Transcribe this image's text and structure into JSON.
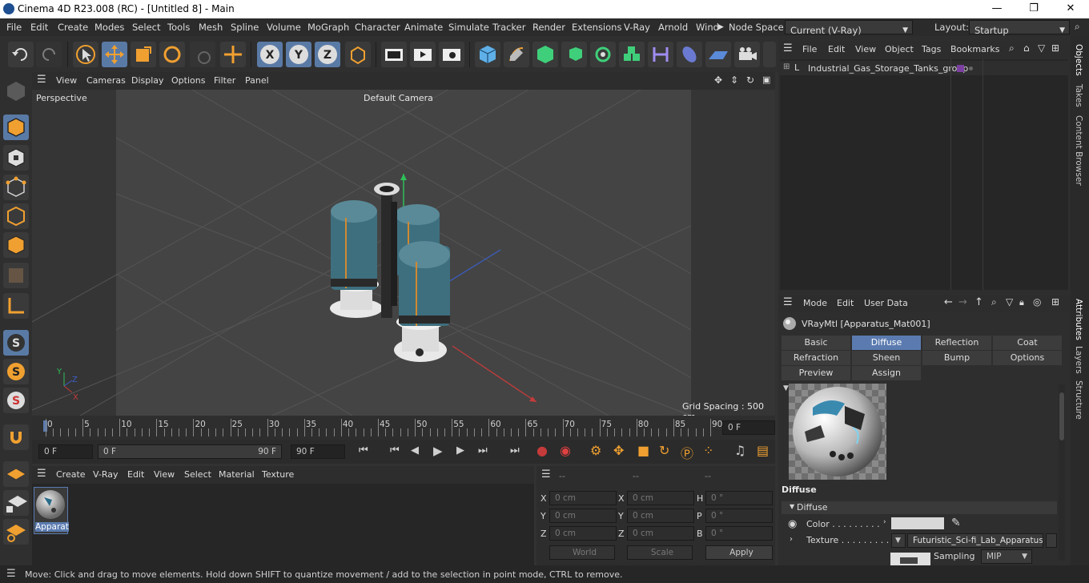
{
  "window": {
    "title": "Cinema 4D R23.008 (RC) - [Untitled 8] - Main",
    "min": "—",
    "max": "❐",
    "close": "✕"
  },
  "menu": [
    "File",
    "Edit",
    "Create",
    "Modes",
    "Select",
    "Tools",
    "Mesh",
    "Spline",
    "Volume",
    "MoGraph",
    "Character",
    "Animate",
    "Simulate",
    "Tracker",
    "Render",
    "Extensions",
    "V-Ray",
    "Arnold",
    "Wind"
  ],
  "node_space": {
    "label": "Node Space:",
    "value": "Current (V-Ray)"
  },
  "layout": {
    "label": "Layout:",
    "value": "Startup"
  },
  "axis_buttons": [
    "X",
    "Y",
    "Z"
  ],
  "viewport": {
    "menu": [
      "View",
      "Cameras",
      "Display",
      "Options",
      "Filter",
      "Panel"
    ],
    "label": "Perspective",
    "camera": "Default Camera",
    "grid_spacing": "Grid Spacing : 500 cm"
  },
  "timeline": {
    "ticks": [
      "0",
      "5",
      "10",
      "15",
      "20",
      "25",
      "30",
      "35",
      "40",
      "45",
      "50",
      "55",
      "60",
      "65",
      "70",
      "75",
      "80",
      "85",
      "90"
    ],
    "current_frame": "0 F"
  },
  "transport": {
    "start": "0 F",
    "range_start": "0 F",
    "range_end": "90 F",
    "end": "90 F"
  },
  "material_panel": {
    "menu": [
      "Create",
      "V-Ray",
      "Edit",
      "View",
      "Select",
      "Material",
      "Texture"
    ],
    "material_label": "Apparat"
  },
  "coords": {
    "headers": [
      "--",
      "--",
      "--"
    ],
    "rows": [
      {
        "a": "X",
        "av": "0 cm",
        "b": "X",
        "bv": "0 cm",
        "c": "H",
        "cv": "0 °"
      },
      {
        "a": "Y",
        "av": "0 cm",
        "b": "Y",
        "bv": "0 cm",
        "c": "P",
        "cv": "0 °"
      },
      {
        "a": "Z",
        "av": "0 cm",
        "b": "Z",
        "bv": "0 cm",
        "c": "B",
        "cv": "0 °"
      }
    ],
    "world": "World",
    "scale": "Scale",
    "apply": "Apply"
  },
  "objects": {
    "menu": [
      "File",
      "Edit",
      "View",
      "Object",
      "Tags",
      "Bookmarks"
    ],
    "items": [
      {
        "name": "Industrial_Gas_Storage_Tanks_group"
      }
    ]
  },
  "attributes": {
    "menu": [
      "Mode",
      "Edit",
      "User Data"
    ],
    "material_title": "VRayMtl [Apparatus_Mat001]",
    "tabs_row1": [
      "Basic",
      "Diffuse",
      "Reflection",
      "Coat"
    ],
    "tabs_row2": [
      "Refraction",
      "Sheen",
      "Bump",
      "Options"
    ],
    "tabs_row3": [
      "Preview Settings",
      "Assign"
    ],
    "section": "Diffuse",
    "subsection": "Diffuse",
    "color_label": "Color . . . . . . . . .",
    "texture_label": "Texture . . . . . . . . .",
    "texture_value": "Futuristic_Sci-fi_Lab_Apparatus_B",
    "sampling_label": "Sampling",
    "sampling_value": "MIP"
  },
  "side_tabs": [
    "Objects",
    "Takes",
    "Content Browser",
    "Attributes",
    "Layers",
    "Structure"
  ],
  "status": "Move: Click and drag to move elements. Hold down SHIFT to quantize movement / add to the selection in point mode, CTRL to remove."
}
